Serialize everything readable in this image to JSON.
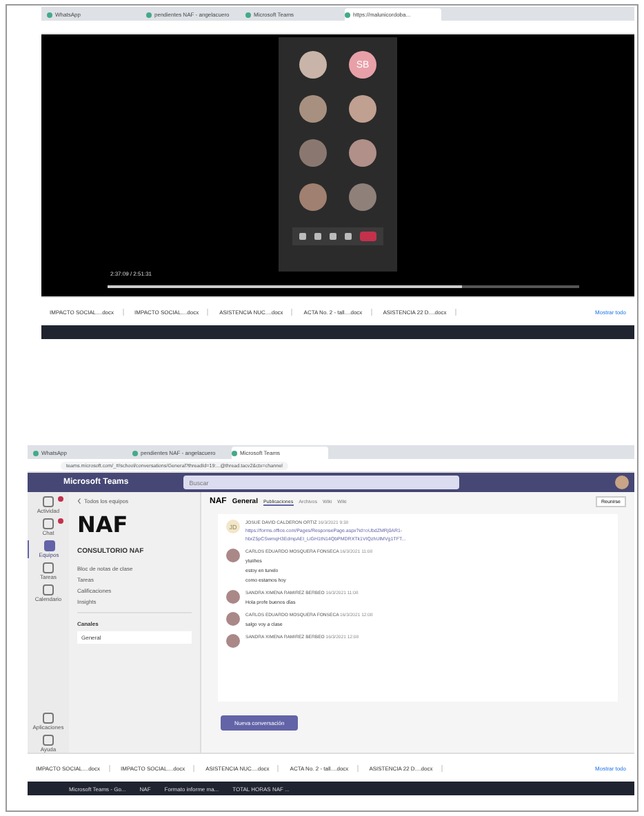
{
  "shot_1": {
    "browser_tabs": [
      {
        "label": "WhatsApp",
        "selected": false
      },
      {
        "label": "pendientes NAF - angelacuero",
        "selected": false
      },
      {
        "label": "Microsoft Teams",
        "selected": false
      },
      {
        "label": "https://malunicordoba...",
        "selected": true
      }
    ],
    "video": {
      "participants": [
        {
          "color": "#c8b4a8"
        },
        {
          "initials": "SB",
          "color": "#e8a0a8"
        },
        {
          "color": "#a89080"
        },
        {
          "color": "#c0a090"
        },
        {
          "color": "#8a7870"
        },
        {
          "color": "#b09088"
        },
        {
          "color": "#a08070"
        },
        {
          "color": "#90807a"
        }
      ],
      "time": "2:37:09 / 2:51:31",
      "level": 0.75
    },
    "downloads": [
      "IMPACTO SOCIAL....docx",
      "IMPACTO SOCIAL....docx",
      "ASISTENCIA NUC....docx",
      "ACTA No. 2 - tall....docx",
      "ASISTENCIA 22 D....docx"
    ],
    "show_all": "Mostrar todo"
  },
  "shot_2": {
    "browser_tabs": [
      {
        "label": "WhatsApp",
        "selected": false
      },
      {
        "label": "pendientes NAF - angelacuero",
        "selected": false
      },
      {
        "label": "Microsoft Teams",
        "selected": true
      }
    ],
    "address": "teams.microsoft.com/_#/school/conversations/General?threadId=19:...@thread.tacv2&ctx=channel",
    "app_title": "Microsoft Teams",
    "search": {
      "placeholder": "Buscar"
    },
    "rail": [
      {
        "label": "Actividad",
        "selected": false,
        "badge": true
      },
      {
        "label": "Chat",
        "selected": false,
        "badge": true
      },
      {
        "label": "Equipos",
        "selected": true,
        "badge": false
      },
      {
        "label": "Tareas",
        "selected": false,
        "badge": false
      },
      {
        "label": "Calendario",
        "selected": false,
        "badge": false
      }
    ],
    "rail_bottom": [
      "Aplicaciones",
      "Ayuda"
    ],
    "sidebar": {
      "back": "Todos los equipos",
      "logo": "NAF",
      "team": "CONSULTORIO NAF",
      "items": [
        "Bloc de notas de clase",
        "Tareas",
        "Calificaciones",
        "Insights"
      ],
      "section": "Canales",
      "channels": [
        {
          "label": "General",
          "selected": true
        }
      ]
    },
    "channel": {
      "logo": "NAF",
      "title": "General",
      "tabs": [
        {
          "label": "Publicaciones",
          "selected": true
        },
        {
          "label": "Archivos",
          "selected": false
        },
        {
          "label": "Wiki",
          "selected": false
        },
        {
          "label": "Wiki",
          "selected": false
        }
      ],
      "meet": "Reunirse"
    },
    "messages": [
      {
        "author": "JOSUE DAVID CALDERON ORTIZ",
        "time": "16/3/2021 9:38",
        "avatar": "JD",
        "lines": [
          "https://forms.office.com/Pages/ResponsePage.aspx?id=oUbdZMRj0AR1-",
          "hbrZ5pCSwmqH3EdmpAEI_LiGH1tN14QbPMDRXTk1VIQzhUlMVg1TFT..."
        ],
        "kind": "link"
      },
      {
        "author": "CARLOS EDUARDO MOSQUERA FONSECA",
        "time": "16/3/2021 11:08",
        "lines": [
          "ytuiihes",
          "estoy en tunelo",
          "como estamos hoy"
        ],
        "kind": "text"
      },
      {
        "author": "SANDRA XIMENA RAMIREZ BERBEO",
        "time": "16/3/2021 11:08",
        "lines": [
          "Hola profe buenos días"
        ],
        "kind": "text"
      },
      {
        "author": "CARLOS EDUARDO MOSQUERA FONSECA",
        "time": "16/3/2021 12:08",
        "lines": [
          "salgo voy a clase"
        ],
        "kind": "text"
      },
      {
        "author": "SANDRA XIMENA RAMIREZ BERBEO",
        "time": "16/3/2021 12:08",
        "kind": "text"
      }
    ],
    "new_conversation": "Nueva conversación",
    "downloads": [
      "IMPACTO SOCIAL....docx",
      "IMPACTO SOCIAL....docx",
      "ASISTENCIA NUC....docx",
      "ACTA No. 2 - tall....docx",
      "ASISTENCIA 22 D....docx"
    ],
    "show_all": "Mostrar todo",
    "taskbar": [
      "Microsoft Teams - Go...",
      "NAF",
      "Formato informe ma...",
      "TOTAL HORAS NAF ..."
    ]
  }
}
